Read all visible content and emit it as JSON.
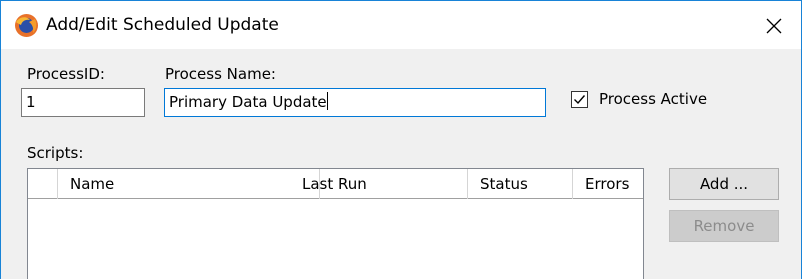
{
  "window": {
    "title": "Add/Edit Scheduled Update",
    "icon": "firefox-like-app-icon",
    "close_icon": "close-icon"
  },
  "form": {
    "process_id_label": "ProcessID:",
    "process_id_value": "1",
    "process_name_label": "Process Name:",
    "process_name_value": "Primary Data Update",
    "process_active_label": "Process Active",
    "process_active_checked": true,
    "scripts_label": "Scripts:"
  },
  "scripts_grid": {
    "columns": [
      "",
      "Name",
      "Last Run",
      "Status",
      "Errors"
    ],
    "rows": []
  },
  "buttons": {
    "add_label": "Add ...",
    "remove_label": "Remove",
    "remove_enabled": false
  },
  "colors": {
    "accent_border": "#1883d7",
    "focus_border": "#0078d7",
    "dialog_bg": "#f0f0f0"
  }
}
